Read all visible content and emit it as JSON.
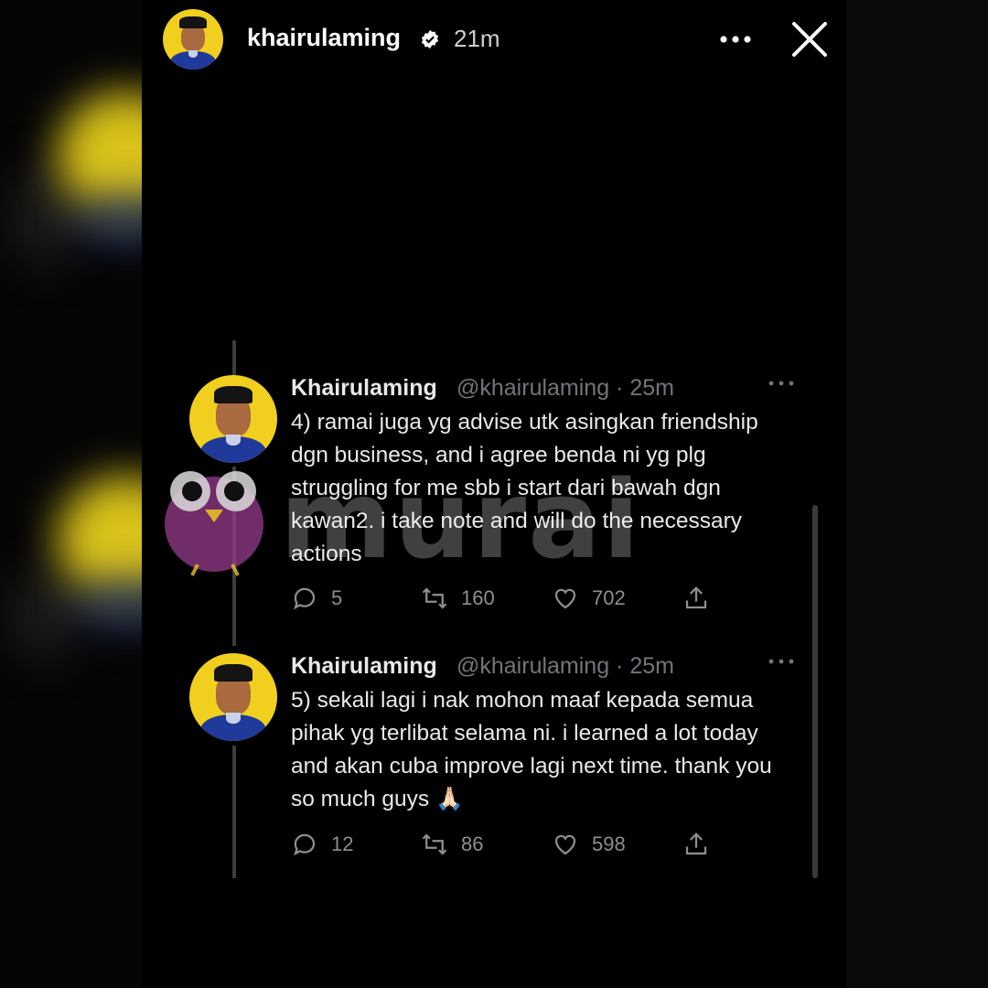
{
  "story": {
    "username": "khairulaming",
    "time": "21m",
    "verified": true
  },
  "tweets": [
    {
      "name": "Khairulaming",
      "handle_time": "@khairulaming · 25m",
      "text": "4) ramai juga yg advise utk asingkan friendship dgn business, and i agree benda ni yg plg struggling for me sbb i start dari bawah dgn kawan2. i take note and will do the necessary actions",
      "replies": "5",
      "retweets": "160",
      "likes": "702"
    },
    {
      "name": "Khairulaming",
      "handle_time": "@khairulaming · 25m",
      "text": "5) sekali lagi i nak mohon maaf kepada semua pihak yg terlibat selama ni. i learned a lot today and akan cuba improve lagi next time. thank you so much guys 🙏🏻",
      "replies": "12",
      "retweets": "86",
      "likes": "598"
    }
  ],
  "watermark": {
    "text": "murai"
  },
  "colors": {
    "avatar_bg": "#f1cf1e",
    "shirt": "#1f3a9a",
    "muted": "#71767b",
    "text": "#e7e9ea"
  }
}
